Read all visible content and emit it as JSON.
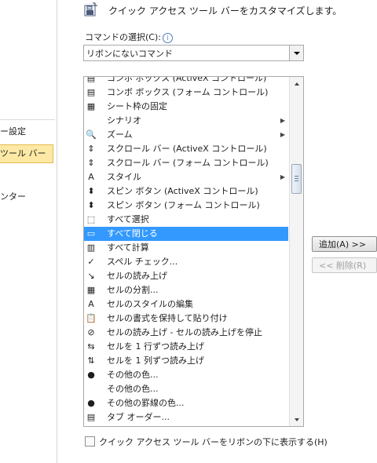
{
  "nav": {
    "items": [
      {
        "label": "ー設定",
        "selected": false
      },
      {
        "label": "ツール バー",
        "selected": true
      },
      {
        "label": "ンター",
        "selected": false
      }
    ]
  },
  "header": {
    "title": "クイック アクセス ツール バーをカスタマイズします。",
    "icon": "qat-customize-icon"
  },
  "command_select": {
    "label": "コマンドの選択(C):",
    "info_glyph": "i",
    "value": "リボンにないコマンド"
  },
  "commands": [
    {
      "label": "コンボ ボックス (ActiveX コントロール)",
      "icon": "combobox-activex-icon",
      "glyph": "▤",
      "submenu": false
    },
    {
      "label": "コンボ ボックス (フォーム コントロール)",
      "icon": "combobox-form-icon",
      "glyph": "▤",
      "submenu": false
    },
    {
      "label": "シート枠の固定",
      "icon": "freeze-panes-icon",
      "glyph": "▦",
      "submenu": false
    },
    {
      "label": "シナリオ",
      "icon": "",
      "glyph": "",
      "submenu": true
    },
    {
      "label": "ズーム",
      "icon": "zoom-icon",
      "glyph": "🔍",
      "submenu": true
    },
    {
      "label": "スクロール バー (ActiveX コントロール)",
      "icon": "scrollbar-activex-icon",
      "glyph": "⇕",
      "submenu": false
    },
    {
      "label": "スクロール バー (フォーム コントロール)",
      "icon": "scrollbar-form-icon",
      "glyph": "⇕",
      "submenu": false
    },
    {
      "label": "スタイル",
      "icon": "style-icon",
      "glyph": "A",
      "submenu": true
    },
    {
      "label": "スピン ボタン (ActiveX コントロール)",
      "icon": "spin-activex-icon",
      "glyph": "⬍",
      "submenu": false
    },
    {
      "label": "スピン ボタン (フォーム コントロール)",
      "icon": "spin-form-icon",
      "glyph": "⬍",
      "submenu": false
    },
    {
      "label": "すべて選択",
      "icon": "select-all-icon",
      "glyph": "⬚",
      "submenu": false
    },
    {
      "label": "すべて閉じる",
      "icon": "close-all-icon",
      "glyph": "▭",
      "submenu": false,
      "selected": true
    },
    {
      "label": "すべて計算",
      "icon": "calculate-all-icon",
      "glyph": "▥",
      "submenu": false
    },
    {
      "label": "スペル チェック...",
      "icon": "spelling-icon",
      "glyph": "✓",
      "submenu": false
    },
    {
      "label": "セルの読み上げ",
      "icon": "speak-cells-icon",
      "glyph": "↘",
      "submenu": false
    },
    {
      "label": "セルの分割...",
      "icon": "split-cells-icon",
      "glyph": "▦",
      "submenu": false
    },
    {
      "label": "セルのスタイルの編集",
      "icon": "edit-cell-style-icon",
      "glyph": "A",
      "submenu": false
    },
    {
      "label": "セルの書式を保持して貼り付け",
      "icon": "paste-format-icon",
      "glyph": "📋",
      "submenu": false
    },
    {
      "label": "セルの読み上げ - セルの読み上げを停止",
      "icon": "stop-speaking-icon",
      "glyph": "⊘",
      "submenu": false
    },
    {
      "label": "セルを 1 行ずつ読み上げ",
      "icon": "speak-by-rows-icon",
      "glyph": "⇆",
      "submenu": false
    },
    {
      "label": "セルを 1 列ずつ読み上げ",
      "icon": "speak-by-columns-icon",
      "glyph": "⇅",
      "submenu": false
    },
    {
      "label": "その他の色...",
      "icon": "more-colors-icon",
      "glyph": "●",
      "submenu": false
    },
    {
      "label": "その他の色...",
      "icon": "",
      "glyph": "",
      "submenu": false
    },
    {
      "label": "その他の罫線の色...",
      "icon": "border-color-icon",
      "glyph": "●",
      "submenu": false
    },
    {
      "label": "タブ オーダー...",
      "icon": "tab-order-icon",
      "glyph": "▤",
      "submenu": false
    }
  ],
  "buttons": {
    "add": "追加(A) >>",
    "remove": "<< 削除(R)"
  },
  "checkbox": {
    "label": "クイック アクセス ツール バーをリボンの下に表示する(H)",
    "checked": false
  },
  "colors": {
    "selection": "#3399ff",
    "nav_selected": "#fde9a5"
  }
}
